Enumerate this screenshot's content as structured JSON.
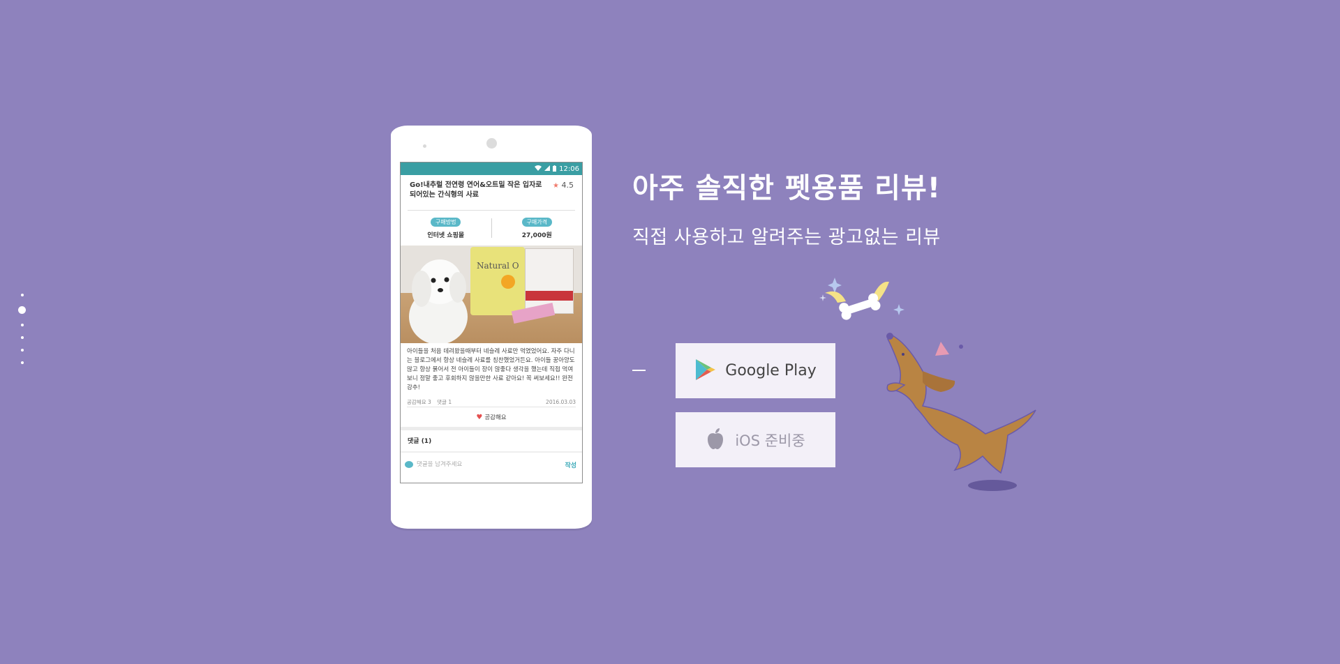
{
  "colors": {
    "background": "#8e82bd",
    "statusbar": "#3a9ea3",
    "pill": "#5ab8c8",
    "star": "#f07a6c",
    "heart": "#e44f4f"
  },
  "pagination": {
    "total": 6,
    "active_index": 1
  },
  "phone": {
    "status_time": "12:06",
    "review": {
      "title": "Go!내추럴 전연령 연어&오트밀 작은 입자로 되어있는 간식형의 사료",
      "rating": "4.5",
      "purchase_method_label": "구매방법",
      "purchase_method_value": "인터넷 쇼핑몰",
      "purchase_price_label": "구매가격",
      "purchase_price_value": "27,000원",
      "bag_brand": "Natural O",
      "body": "아이들을 처음 데려왔을때부터 네슬레 사료만 먹였었어요. 자주 다니는 블로그에서 항상 네슬레 사료를 칭찬했었거든요. 아이들 꿍아양도 많고 항상 묽어서 전 아이들이 장이 않좋다 생각을 했는데 직접 먹여보니 정말 좋고 후회하지 않을만한 사료 같아요! 꼭 써보세요!! 완전 강추!",
      "likes_text": "공감해요 3",
      "comments_count_text": "댓글 1",
      "date": "2016.03.03",
      "like_button": "공감해요"
    },
    "comments": {
      "title": "댓글 (1)",
      "placeholder": "댓글을 남겨주세요",
      "submit": "작성"
    }
  },
  "hero": {
    "headline": "아주 솔직한 펫용품 리뷰!",
    "subheadline": "직접 사용하고 알려주는 광고없는 리뷰"
  },
  "stores": {
    "google_play": "Google Play",
    "ios": "iOS 준비중"
  },
  "icons": [
    "wifi-icon",
    "signal-icon",
    "battery-icon",
    "star-icon",
    "heart-icon",
    "comment-icon",
    "google-play-icon",
    "apple-icon"
  ]
}
